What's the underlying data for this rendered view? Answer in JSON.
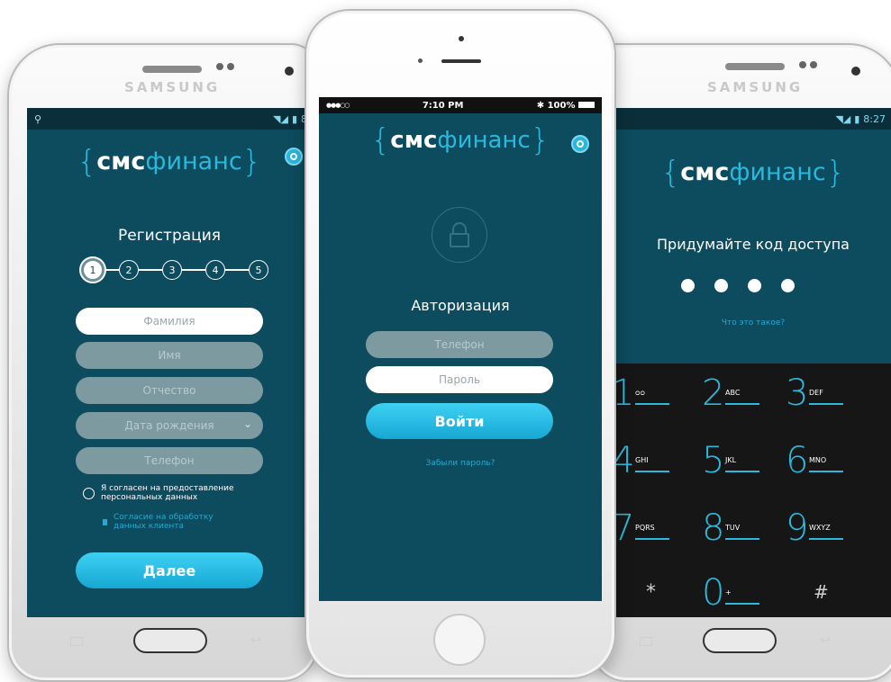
{
  "status": {
    "samsung_time": "8:27",
    "iphone_carrier": "●●●○○",
    "iphone_time": "7:10 PM",
    "iphone_battery": "100%"
  },
  "brand": {
    "samsung_label": "SAMSUNG",
    "logo_left": "{",
    "logo_bold": "смс",
    "logo_rest": "финанс",
    "logo_right": "}"
  },
  "registration": {
    "title": "Регистрация",
    "steps": [
      "1",
      "2",
      "3",
      "4",
      "5"
    ],
    "fields": {
      "surname": "Фамилия",
      "name": "Имя",
      "patronymic": "Отчество",
      "birthdate": "Дата рождения",
      "phone": "Телефон"
    },
    "consent": "Я согласен на предоставление персональных данных",
    "consent_link": "Согласие на обработку данных клиента",
    "next_button": "Далее"
  },
  "login": {
    "title": "Авторизация",
    "phone_placeholder": "Телефон",
    "password_placeholder": "Пароль",
    "login_button": "Войти",
    "forgot_link": "Забыли пароль?"
  },
  "passcode": {
    "title": "Придумайте код доступа",
    "dots_count": 4,
    "what_link": "Что это такое?",
    "keys": [
      {
        "num": "1",
        "letters": "ᴑᴑ"
      },
      {
        "num": "2",
        "letters": "ABC"
      },
      {
        "num": "3",
        "letters": "DEF"
      },
      {
        "num": "4",
        "letters": "GHI"
      },
      {
        "num": "5",
        "letters": "JKL"
      },
      {
        "num": "6",
        "letters": "MNO"
      },
      {
        "num": "7",
        "letters": "PQRS"
      },
      {
        "num": "8",
        "letters": "TUV"
      },
      {
        "num": "9",
        "letters": "WXYZ"
      }
    ],
    "star": "*",
    "zero": "0",
    "zero_letters": "+",
    "hash": "#"
  },
  "colors": {
    "screen_bg": "#0d4b5e",
    "accent": "#2ab9dc",
    "keypad_bg": "#161616"
  }
}
